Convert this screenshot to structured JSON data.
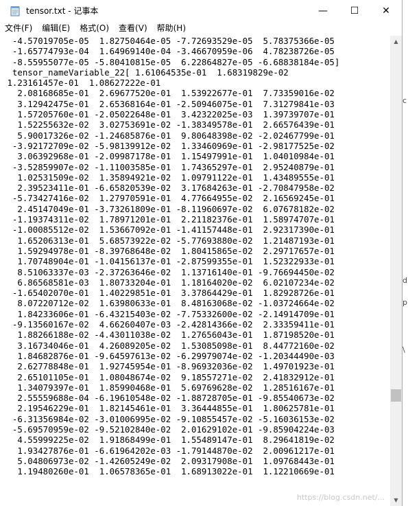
{
  "window": {
    "title": "tensor.txt - 记事本",
    "controls": {
      "minimize": "—",
      "maximize": "☐",
      "close": "✕"
    }
  },
  "menu": [
    {
      "label": "文件(F)"
    },
    {
      "label": "编辑(E)"
    },
    {
      "label": "格式(O)"
    },
    {
      "label": "查看(V)"
    },
    {
      "label": "帮助(H)"
    }
  ],
  "content": {
    "lines": [
      "  -4.57019705e-05  1.82750464e-05 -7.72693529e-05  5.78375366e-05",
      "  -1.65774793e-04  1.64969140e-04 -3.46670959e-06  4.78238726e-05",
      "  -8.55955077e-05 -5.80410815e-05  6.22864827e-05 -6.68838184e-05]",
      "  tensor_nameVariable_22[ 1.61064535e-01  1.68319829e-02",
      " 1.23161457e-01  1.08627222e-01",
      "   2.08168685e-01  2.69677520e-01  1.53922677e-01  7.73359016e-02",
      "   3.12942475e-01  2.65368164e-01 -2.50946075e-01  7.31279841e-03",
      "   1.57205760e-01 -2.05022648e-01  3.42322025e-03  1.39739707e-01",
      "   1.52255632e-02  3.02753691e-02 -1.38349578e-01  2.66576439e-01",
      "   5.90017326e-02 -1.24685876e-01  9.80648398e-02 -2.02467799e-01",
      "  -3.92172709e-02 -5.98139912e-02  1.33460969e-01 -2.98177525e-02",
      "   3.06392968e-01 -2.09987178e-01  1.15497991e-01  1.04010984e-01",
      "  -3.52859907e-02 -1.11003585e-01  1.74365297e-01  2.95240879e-01",
      "   1.02531509e-02  1.35894921e-02  1.09791122e-01  1.43489555e-01",
      "   2.39523411e-01 -6.65820539e-02  3.17684263e-01 -2.70847958e-02",
      "  -5.73427416e-02  1.27970591e-01  4.77664955e-02  2.16569245e-01",
      "   2.45147049e-01 -3.73261809e-01 -8.11960697e-02  6.07678182e-02",
      "  -1.19374311e-02  1.78971201e-01  2.21182376e-01  1.58974707e-01",
      "  -1.00085512e-02  1.53667092e-01 -1.41157448e-01  2.92317390e-01",
      "   1.65206313e-01  5.68573922e-02 -5.77693880e-02  1.21487193e-01",
      "   1.59294978e-01 -8.39768648e-02  1.80415865e-02  2.29717657e-01",
      "   1.70748904e-01 -1.04156137e-01 -2.87599355e-01  1.52322933e-01",
      "   8.51063337e-03 -2.37263646e-02  1.13716140e-01 -9.76694450e-02",
      "   6.86568581e-03  1.80733204e-01  1.18164020e-02  6.02107234e-02",
      "  -1.65402070e-01  1.40229851e-01  3.37864429e-01  1.82928726e-01",
      "   8.07220712e-02  1.63980633e-01  8.48163068e-02 -1.03724664e-02",
      "   1.84233606e-01 -6.43215403e-02 -7.75332600e-02 -2.14914709e-01",
      "  -9.13560167e-02  4.66260407e-03 -2.42814366e-02  2.33359411e-01",
      "   1.88266188e-02 -4.43011038e-02  1.27656043e-01  1.87198520e-01",
      "   3.16734046e-01  4.26089205e-02  1.53085098e-01  8.44772160e-02",
      "   1.84682876e-01 -9.64597613e-02 -6.29979074e-02 -1.20344490e-03",
      "   2.62778848e-01  1.92745954e-01 -8.96932036e-02  1.49701923e-01",
      "   2.65101105e-01  1.08048674e-02  9.18557271e-02  2.41832912e-01",
      "   1.34079397e-01  1.85990468e-01  5.69769628e-02  1.28516167e-01",
      "   2.55559688e-04 -6.19610548e-02 -1.88728705e-01 -9.85540673e-02",
      "   2.19546229e-01  1.82145461e-01  3.36444855e-01  1.80625781e-01",
      "  -6.31356984e-02 -3.01006995e-02 -9.10855457e-02 -5.16036153e-02",
      "  -5.69570959e-02 -9.52102840e-02  2.01629102e-01 -9.85904224e-03",
      "   4.55999225e-02  1.91868499e-01  1.55489147e-01  8.29641819e-02",
      "   1.93427876e-01 -6.61964202e-03 -1.79144870e-02  2.00961217e-01",
      "   5.04806973e-02 -1.42605249e-02  2.09317908e-01  1.09768443e-01",
      "   1.19480260e-01  1.06578365e-01  1.68913022e-01  1.12210669e-01"
    ]
  },
  "background": {
    "right_edge_chars": [
      "c",
      "d",
      "p",
      "\\"
    ],
    "watermark": "https://blog.csdn.net/..."
  }
}
